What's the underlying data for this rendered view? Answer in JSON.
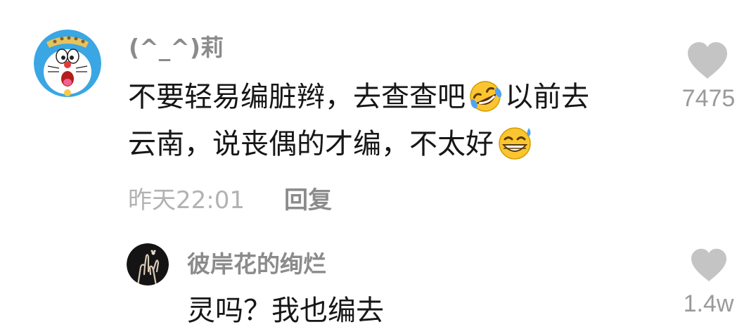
{
  "comment": {
    "username": "(^_^)莉",
    "text_line1_a": "不要轻易编脏辫，去查查吧",
    "text_line1_b": "以前去",
    "text_line2_a": "云南，说丧偶的才编，不太好",
    "emoji_1": "rolling-on-floor-laughing-emoji",
    "emoji_2": "grinning-sweat-emoji",
    "timestamp": "昨天22:01",
    "reply_label": "回复",
    "like_count": "7475",
    "like_icon": "heart-icon",
    "avatar_icon": "doraemon-avatar"
  },
  "reply": {
    "username": "彼岸花的绚烂",
    "text": "灵吗？我也编去",
    "like_count": "1.4w",
    "like_icon": "heart-icon",
    "avatar_icon": "dark-hands-avatar"
  },
  "colors": {
    "text_primary": "#161616",
    "username_gray": "#8b8b8b",
    "meta_gray": "#b2b2b2",
    "heart_gray": "#c4c4c4"
  }
}
